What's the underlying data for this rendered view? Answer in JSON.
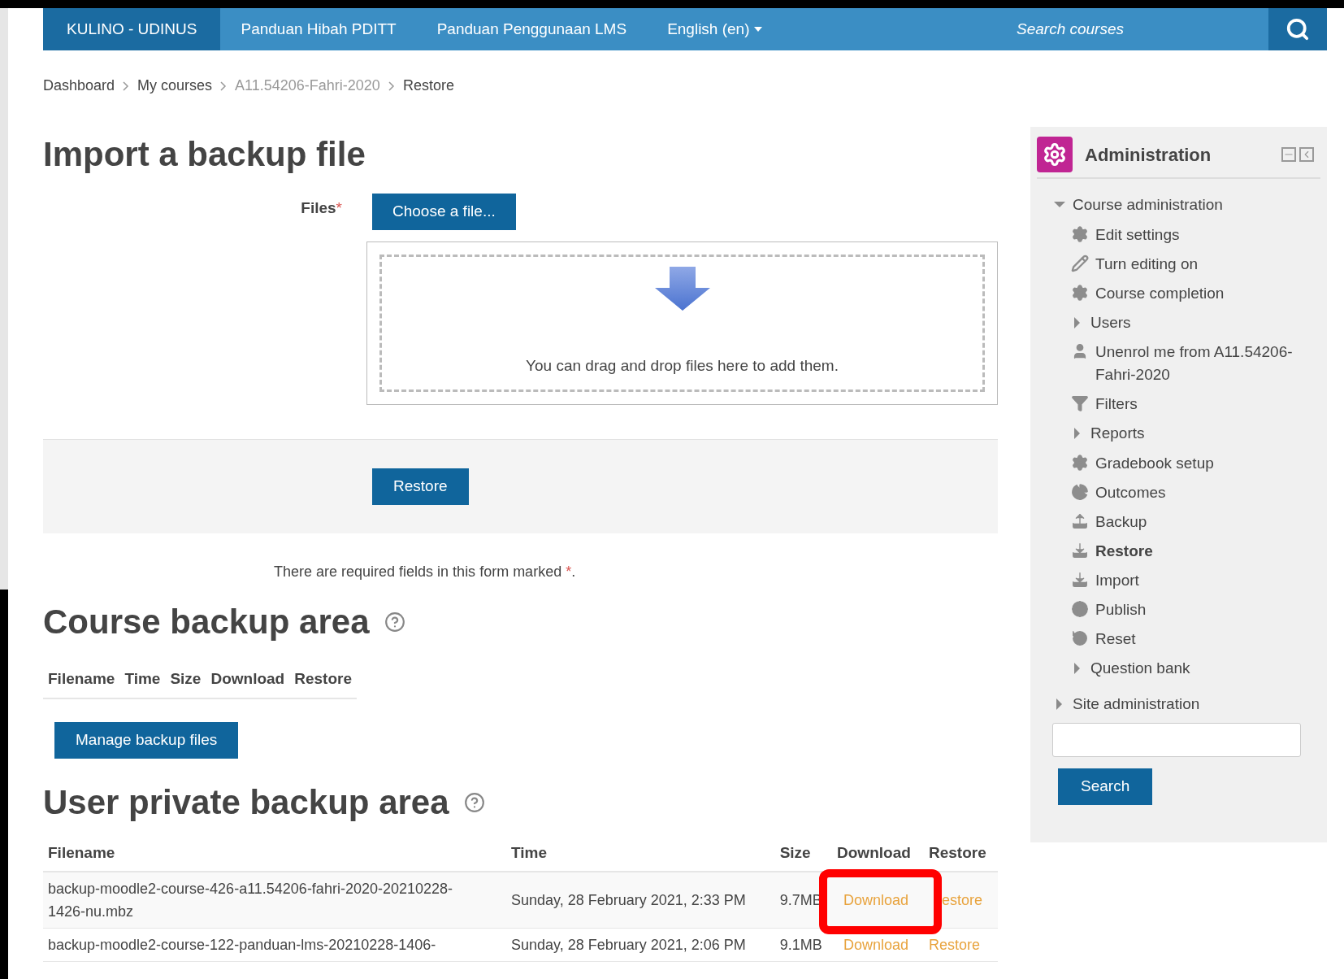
{
  "navbar": {
    "brand": "KULINO - UDINUS",
    "links": [
      {
        "label": "Panduan Hibah PDITT"
      },
      {
        "label": "Panduan Penggunaan LMS"
      }
    ],
    "language": "English (en)",
    "search": {
      "placeholder": "Search courses"
    }
  },
  "breadcrumb": [
    {
      "label": "Dashboard",
      "muted": false
    },
    {
      "label": "My courses",
      "muted": false
    },
    {
      "label": "A11.54206-Fahri-2020",
      "muted": true
    },
    {
      "label": "Restore",
      "muted": false
    }
  ],
  "import": {
    "title": "Import a backup file",
    "files_label": "Files",
    "required_mark": "*",
    "choose_button": "Choose a file...",
    "dropzone_text": "You can drag and drop files here to add them.",
    "restore_button": "Restore",
    "required_note": "There are required fields in this form marked",
    "required_note_end": "."
  },
  "course_backup": {
    "title": "Course backup area",
    "columns": [
      "Filename",
      "Time",
      "Size",
      "Download",
      "Restore"
    ],
    "manage_button": "Manage backup files"
  },
  "user_backup": {
    "title": "User private backup area",
    "columns": [
      "Filename",
      "Time",
      "Size",
      "Download",
      "Restore"
    ],
    "rows": [
      {
        "filename": "backup-moodle2-course-426-a11.54206-fahri-2020-20210228-1426-nu.mbz",
        "time": "Sunday, 28 February 2021, 2:33 PM",
        "size": "9.7MB",
        "download": "Download",
        "restore": "estore",
        "highlighted": true
      },
      {
        "filename": "backup-moodle2-course-122-panduan-lms-20210228-1406-",
        "time": "Sunday, 28 February 2021, 2:06 PM",
        "size": "9.1MB",
        "download": "Download",
        "restore": "Restore",
        "highlighted": false
      }
    ]
  },
  "administration": {
    "title": "Administration",
    "tree": [
      {
        "label": "Course administration",
        "kind": "branch",
        "expanded": true,
        "children": [
          {
            "label": "Edit settings",
            "kind": "link",
            "selected": false
          },
          {
            "label": "Turn editing on",
            "kind": "link",
            "selected": false
          },
          {
            "label": "Course completion",
            "kind": "link",
            "selected": false
          },
          {
            "label": "Users",
            "kind": "branch",
            "expanded": false
          },
          {
            "label": "Unenrol me from A11.54206-Fahri-2020",
            "kind": "link",
            "selected": false
          },
          {
            "label": "Filters",
            "kind": "link",
            "selected": false
          },
          {
            "label": "Reports",
            "kind": "branch",
            "expanded": false
          },
          {
            "label": "Gradebook setup",
            "kind": "link",
            "selected": false
          },
          {
            "label": "Outcomes",
            "kind": "link",
            "selected": false
          },
          {
            "label": "Backup",
            "kind": "link",
            "selected": false
          },
          {
            "label": "Restore",
            "kind": "link",
            "selected": true
          },
          {
            "label": "Import",
            "kind": "link",
            "selected": false
          },
          {
            "label": "Publish",
            "kind": "link",
            "selected": false
          },
          {
            "label": "Reset",
            "kind": "link",
            "selected": false
          },
          {
            "label": "Question bank",
            "kind": "branch",
            "expanded": false
          }
        ]
      },
      {
        "label": "Site administration",
        "kind": "branch",
        "expanded": false
      }
    ],
    "search_button": "Search"
  }
}
